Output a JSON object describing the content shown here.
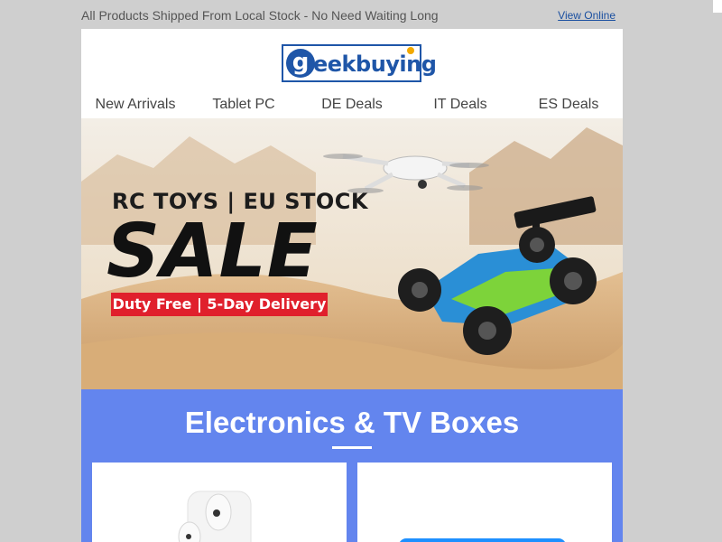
{
  "top": {
    "promo": "All Products Shipped From Local Stock - No Need Waiting Long",
    "view_online": "View Online"
  },
  "logo": {
    "letter": "g",
    "eek": "eek",
    "buying": "buying"
  },
  "nav": {
    "items": [
      {
        "label": "New Arrivals"
      },
      {
        "label": "Tablet PC"
      },
      {
        "label": "DE Deals"
      },
      {
        "label": "IT Deals"
      },
      {
        "label": "ES Deals"
      }
    ]
  },
  "banner": {
    "line1": "RC TOYS | EU STOCK",
    "line2": "SALE",
    "line3": "Duty Free | 5-Day Delivery"
  },
  "section": {
    "title": "Electronics & TV Boxes"
  },
  "colors": {
    "brand_blue": "#1f56a8",
    "section_blue": "#6385ee",
    "badge_red": "#e0202c",
    "sand": "#e7c9a2"
  },
  "icons": {
    "drone": "drone-image",
    "rc_car": "rc-car-image",
    "earbuds": "earbuds-image",
    "tv_box": "tv-box-image"
  }
}
